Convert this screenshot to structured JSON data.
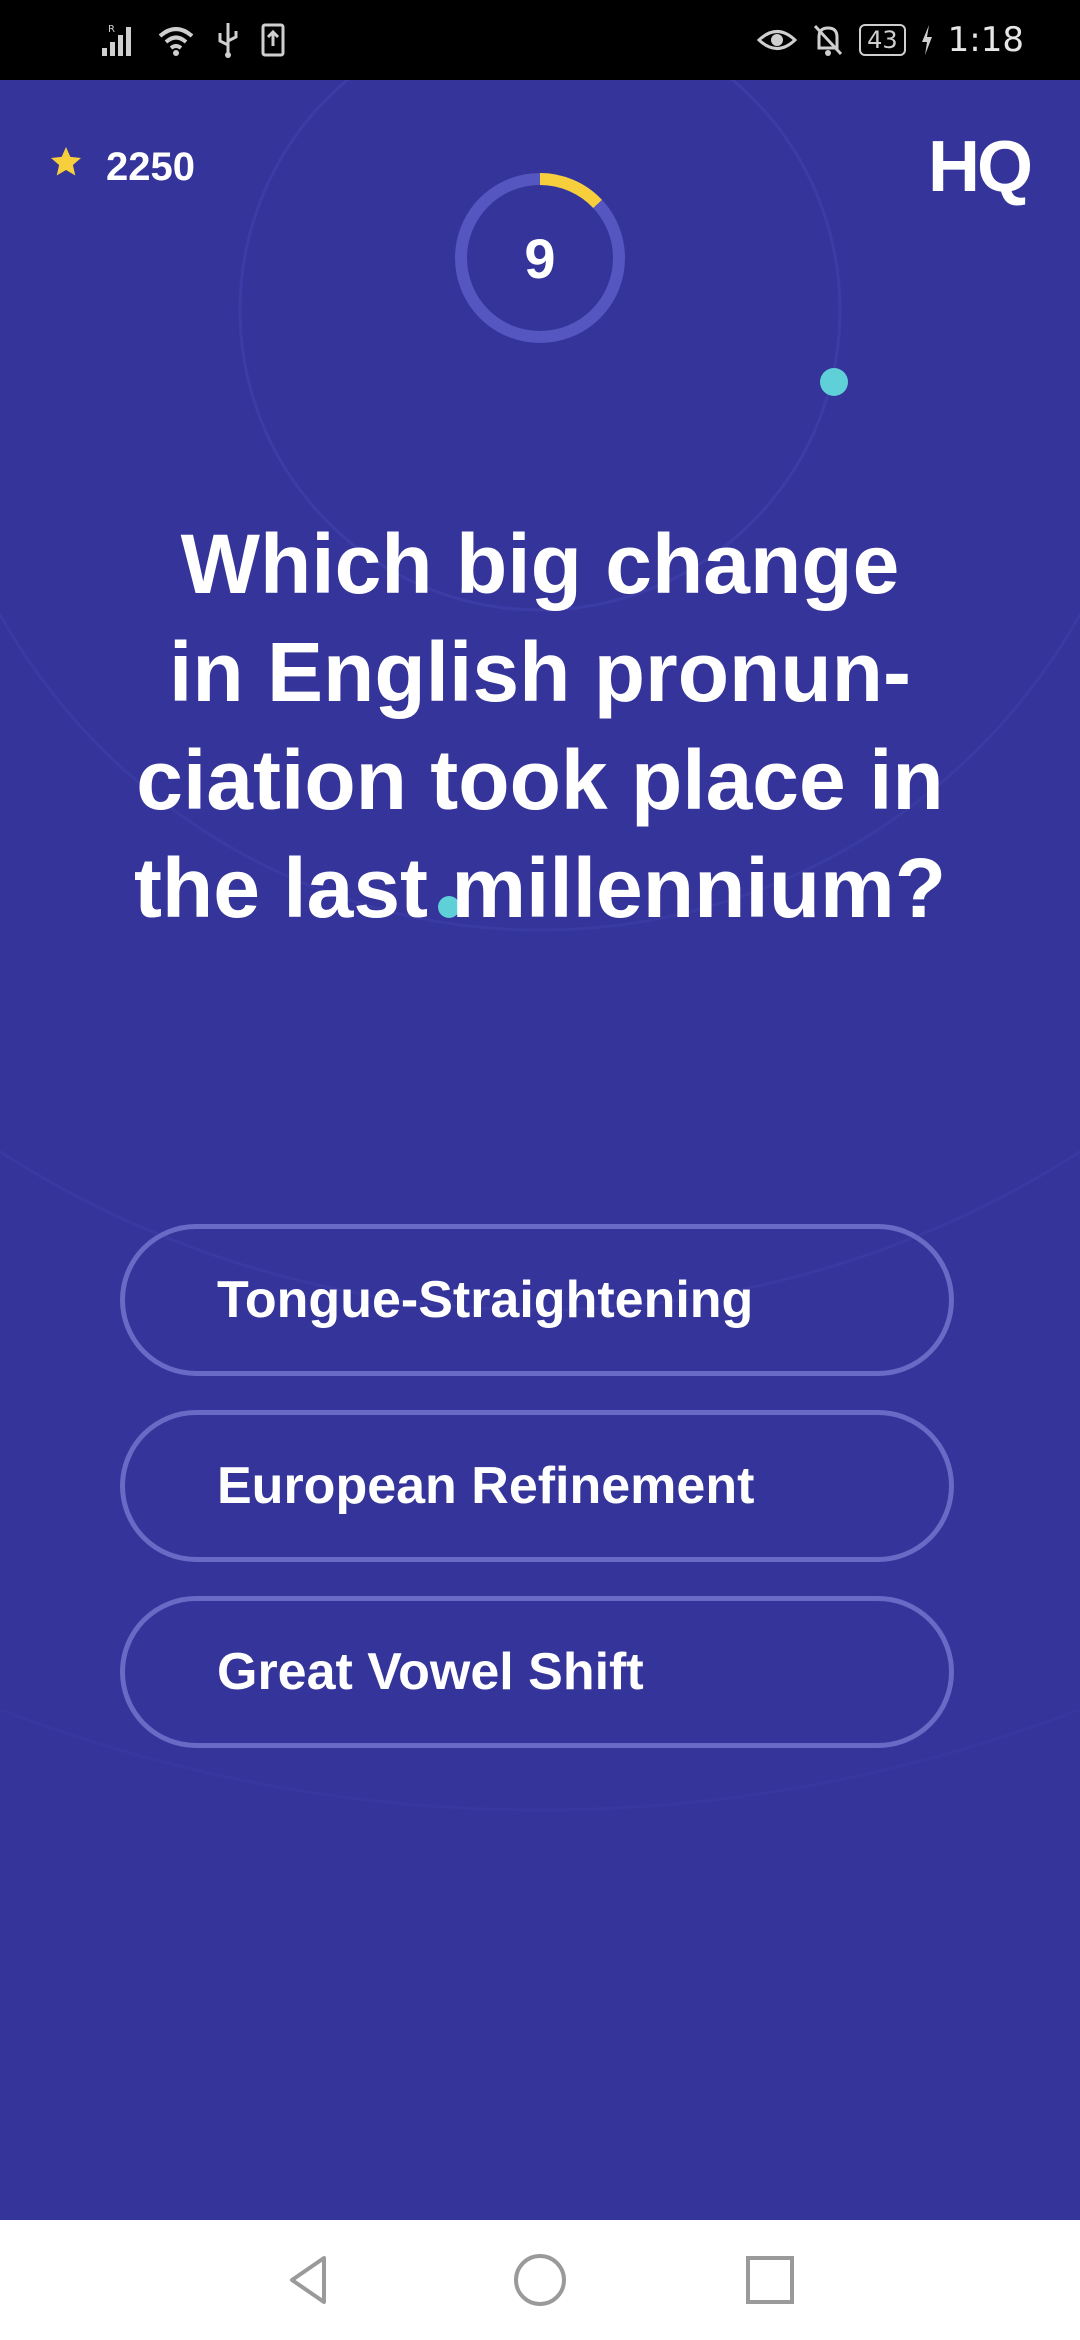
{
  "status_bar": {
    "battery": "43",
    "time": "1:18"
  },
  "header": {
    "score": "2250",
    "logo": "HQ"
  },
  "timer": {
    "value": "9",
    "progress_fraction": 0.13
  },
  "question": {
    "text": "Which big change in English pronun-ciation took place in the last millennium?",
    "lines": [
      "Which big change",
      "in English pronun-",
      "ciation took place in",
      "the last millennium?"
    ]
  },
  "answers": [
    {
      "label": "Tongue-Straightening"
    },
    {
      "label": "European Refinement"
    },
    {
      "label": "Great Vowel Shift"
    }
  ],
  "colors": {
    "background": "#34349a",
    "accent_yellow": "#f7cf3c",
    "dot_cyan": "#5fd0d8",
    "answer_border": "#6969c6"
  },
  "icons": {
    "status_left": [
      "signal-icon",
      "wifi-icon",
      "usb-icon",
      "download-icon"
    ],
    "status_right": [
      "eye-icon",
      "mute-bell-icon",
      "battery-icon",
      "charging-icon"
    ],
    "nav": [
      "back-icon",
      "home-icon",
      "recents-icon"
    ]
  }
}
